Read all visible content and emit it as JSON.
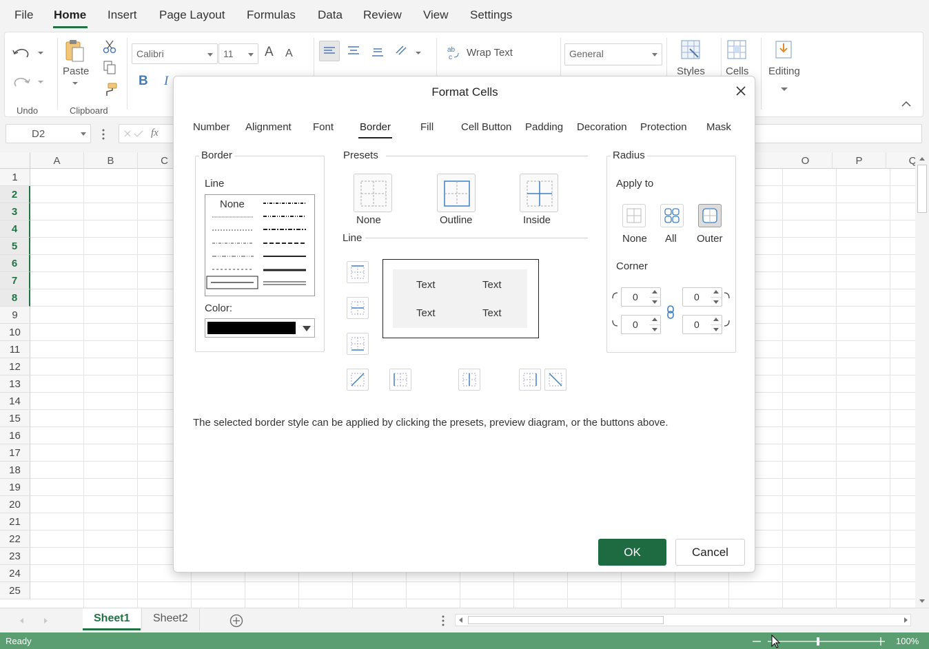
{
  "menu": {
    "items": [
      "File",
      "Home",
      "Insert",
      "Page Layout",
      "Formulas",
      "Data",
      "Review",
      "View",
      "Settings"
    ],
    "active": "Home"
  },
  "ribbon": {
    "groups": {
      "undo": "Undo",
      "clipboard": "Clipboard"
    },
    "paste_label": "Paste",
    "font_name": "Calibri",
    "font_size": "11",
    "bold": "B",
    "italic": "I",
    "grow_font": "A",
    "shrink_font": "A",
    "wrap_text": "Wrap Text",
    "number_format": "General",
    "styles_label": "Styles",
    "cells_label": "Cells",
    "editing_label": "Editing",
    "accent_color": "#217346"
  },
  "formula_bar": {
    "name_box": "D2",
    "fx_label": "fx"
  },
  "grid": {
    "columns_left": [
      "A",
      "B",
      "C"
    ],
    "columns_right": [
      "O",
      "P",
      "Q"
    ],
    "rows": [
      "1",
      "2",
      "3",
      "4",
      "5",
      "6",
      "7",
      "8",
      "9",
      "10",
      "11",
      "12",
      "13",
      "14",
      "15",
      "16",
      "17",
      "18",
      "19",
      "20",
      "21",
      "22",
      "23",
      "24",
      "25"
    ],
    "selected_rows": [
      "2",
      "3",
      "4",
      "5",
      "6",
      "7",
      "8"
    ]
  },
  "sheets": {
    "tabs": [
      "Sheet1",
      "Sheet2"
    ],
    "active": "Sheet1"
  },
  "status": {
    "text": "Ready",
    "zoom": "100%",
    "bar_color": "#5a9e72"
  },
  "dialog": {
    "title": "Format Cells",
    "tabs": [
      "Number",
      "Alignment",
      "Font",
      "Border",
      "Fill",
      "Cell Button",
      "Padding",
      "Decoration",
      "Protection",
      "Mask"
    ],
    "active_tab": "Border",
    "border_section": {
      "legend": "Border",
      "line_label": "Line",
      "line_none": "None",
      "color_label": "Color:",
      "color_value": "#000000"
    },
    "presets_section": {
      "legend": "Presets",
      "items": [
        "None",
        "Outline",
        "Inside"
      ],
      "line_label": "Line",
      "preview_text": [
        "Text",
        "Text",
        "Text",
        "Text"
      ]
    },
    "radius_section": {
      "legend": "Radius",
      "apply_to_label": "Apply to",
      "apply_options": [
        "None",
        "All",
        "Outer"
      ],
      "selected_apply": "Outer",
      "corner_label": "Corner",
      "corners": {
        "top_left": "0",
        "top_right": "0",
        "bottom_left": "0",
        "bottom_right": "0"
      }
    },
    "hint": "The selected border style can be applied by clicking the presets, preview diagram, or the buttons above.",
    "ok_label": "OK",
    "cancel_label": "Cancel"
  }
}
